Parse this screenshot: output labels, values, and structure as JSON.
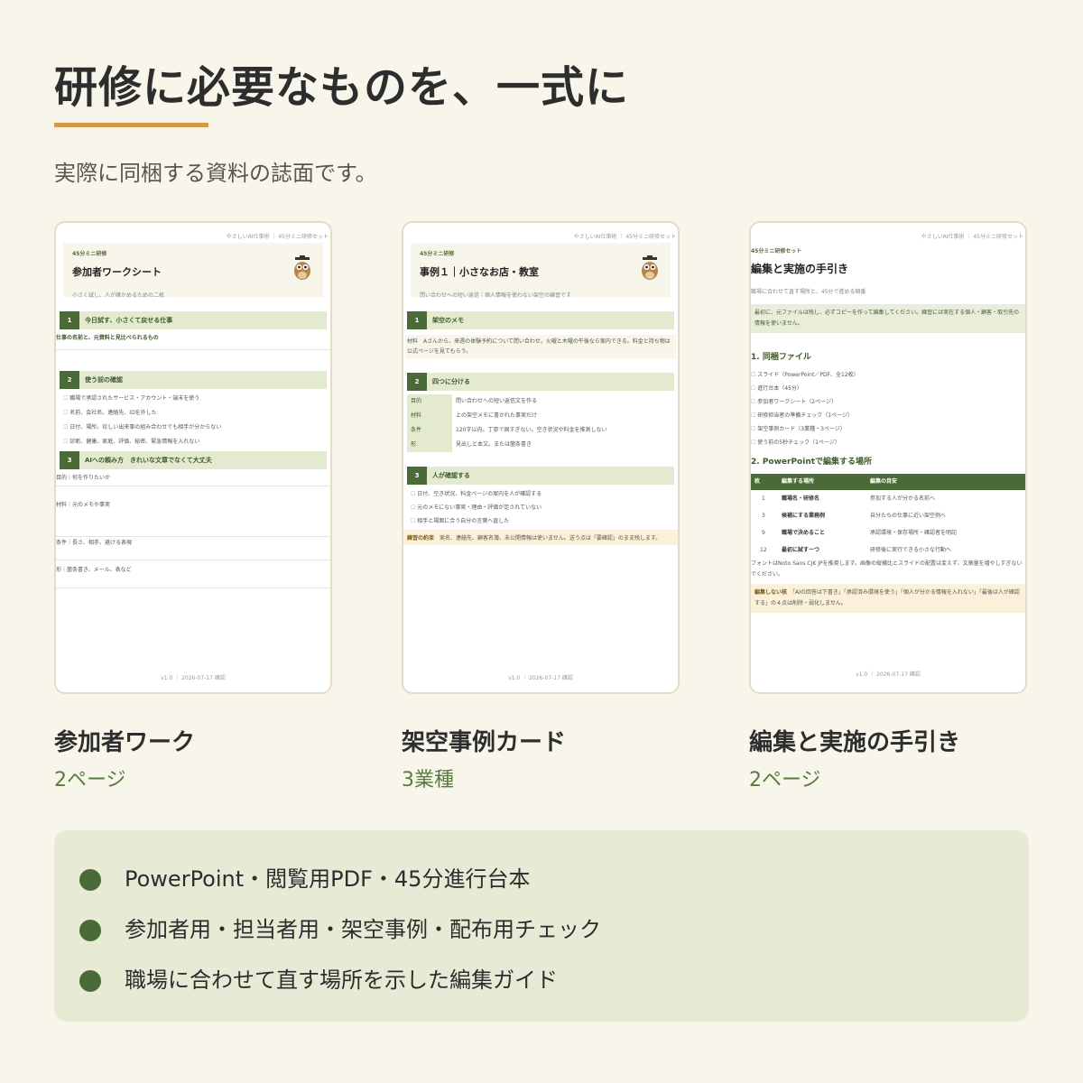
{
  "page": {
    "title": "研修に必要なものを、一式に",
    "subtitle": "実際に同梱する資料の誌面です。"
  },
  "cards": [
    {
      "header": "やさしいAI仕事術 ｜ 45分ミニ研修セット",
      "kicker": "45分ミニ研修",
      "title": "参加者ワークシート",
      "doc_subtitle": "小さく試し、人が確かめるための二枚",
      "sections": [
        {
          "num": "1",
          "label": "今日試す、小さくて戻せる仕事"
        },
        {
          "num": "2",
          "label": "使う前の確認"
        },
        {
          "num": "3",
          "label": "AIへの頼み方　きれいな文章でなくて大丈夫"
        }
      ],
      "sec1_line": "仕事の名前と、元資料と見比べられるもの",
      "checks": [
        "職場で承認されたサービス・アカウント・端末を使う",
        "名前、会社名、連絡先、IDを外した",
        "日付、場所、珍しい出来事の組み合わせでも相手が分からない",
        "診断、健康、家庭、評価、秘密、緊急情報を入れない"
      ],
      "fields": [
        "目的｜何を作りたいか",
        "材料｜元のメモや事実",
        "条件｜長さ、相手、避ける表現",
        "形｜箇条書き、メール、表など"
      ],
      "footer": "v1.0 ｜ 2026-07-17 確認",
      "caption": "参加者ワーク",
      "caption_sub": "2ページ"
    },
    {
      "header": "やさしいAI仕事術 ｜ 45分ミニ研修セット",
      "kicker": "45分ミニ研修",
      "title": "事例１｜小さなお店・教室",
      "doc_subtitle": "問い合わせへの短い返信｜個人情報を使わない架空の練習です",
      "sections": [
        {
          "num": "1",
          "label": "架空のメモ"
        },
        {
          "num": "2",
          "label": "四つに分ける"
        },
        {
          "num": "3",
          "label": "人が確認する"
        }
      ],
      "memo": "材料　Aさんから、来週の体験予約について問い合わせ。火曜と木曜の午後なら案内できる。料金と持ち物は公式ページを見てもらう。",
      "table": [
        {
          "k": "目的",
          "v": "問い合わせへの短い返信文を作る"
        },
        {
          "k": "材料",
          "v": "上の架空メモに書かれた事実だけ"
        },
        {
          "k": "条件",
          "v": "120字以内。丁寧で固すぎない。空き状況や料金を推測しない"
        },
        {
          "k": "形",
          "v": "見出しと本文。または箇条書き"
        }
      ],
      "checks": [
        "日付、空き状況、料金ページの案内を人が確認する",
        "元のメモにない事実・理由・評価が足されていない",
        "相手と場面に合う自分の言葉へ直した"
      ],
      "note_label": "練習の約束",
      "note": "実名、連絡先、顧客名簿、未公開情報は使いません。送う点は「要確認」のまま残します。",
      "footer": "v1.0 ｜ 2026-07-17 確認",
      "caption": "架空事例カード",
      "caption_sub": "3業種"
    },
    {
      "header": "やさしいAI仕事術 ｜ 45分ミニ研修セット",
      "kicker": "45分ミニ研修セット",
      "title": "編集と実施の手引き",
      "doc_subtitle": "職場に合わせて直す場所と、45分で進める順番",
      "intro": "最初に、元ファイルは残し、必ずコピーを作って編集してください。練習には実在する個人・顧客・取引先の情報を使いません。",
      "h2_1": "1. 同梱ファイル",
      "files": [
        "スライド（PowerPoint／PDF、全12枚）",
        "進行台本（45分）",
        "参加者ワークシート（2ページ）",
        "研修担当者の準備チェック（1ページ）",
        "架空事例カード（3業種・3ページ）",
        "使う前の5秒チェック（1ページ）"
      ],
      "h2_2": "2. PowerPointで編集する場所",
      "thead": [
        "枚",
        "編集する場所",
        "編集の目安"
      ],
      "rows": [
        [
          "1",
          "職場名・研修名",
          "参加する人が分かる名前へ"
        ],
        [
          "3",
          "候補にする業務例",
          "自分たちの仕事に近い架空例へ"
        ],
        [
          "9",
          "職場で決めること",
          "承認環境・保存場所・確認者を明記"
        ],
        [
          "12",
          "最初に試すーつ",
          "研修後に実行できる小さな行動へ"
        ]
      ],
      "font_note": "フォントはNoto Sans CJK JPを推奨します。画像の縦横比とスライドの配置は変えず、文章量を増やしすぎないでください。",
      "note_label": "編集しない核",
      "note": "「AIの回答は下書き」「承認済み環境を使う」「個人が分かる情報を入れない」「最後は人が確認する」の４点は削除・弱化しません。",
      "footer": "v1.0 ｜ 2026-07-17 確認",
      "caption": "編集と実施の手引き",
      "caption_sub": "2ページ"
    }
  ],
  "bullets": [
    "PowerPoint・閲覧用PDF・45分進行台本",
    "参加者用・担当者用・架空事例・配布用チェック",
    "職場に合わせて直す場所を示した編集ガイド"
  ],
  "colors": {
    "background": "#f8f6ea",
    "accent": "#d39a4a",
    "brand_green": "#4a6b37",
    "panel": "#e7ebd6"
  }
}
